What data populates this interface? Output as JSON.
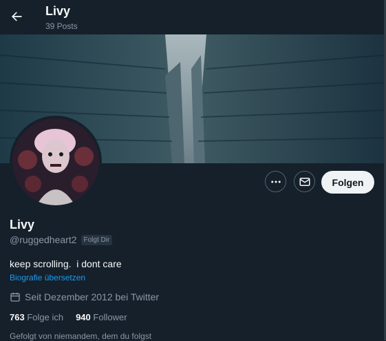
{
  "header": {
    "title": "Livy",
    "post_count": "39 Posts"
  },
  "profile": {
    "name": "Livy",
    "handle": "@ruggedheart2",
    "follows_you_badge": "Folgt Dir",
    "bio": "keep scrolling.  i dont care",
    "translate_link": "Biografie übersetzen",
    "joined": "Seit Dezember 2012 bei Twitter",
    "following_count": "763",
    "following_label": "Folge ich",
    "followers_count": "940",
    "followers_label": "Follower",
    "followed_by": "Gefolgt von niemandem, dem du folgst"
  },
  "actions": {
    "more_icon": "more-icon",
    "message_icon": "mail-icon",
    "follow_label": "Folgen"
  },
  "colors": {
    "background": "#15202b",
    "accent": "#1d9bf0",
    "secondary_text": "#8b98a5"
  }
}
